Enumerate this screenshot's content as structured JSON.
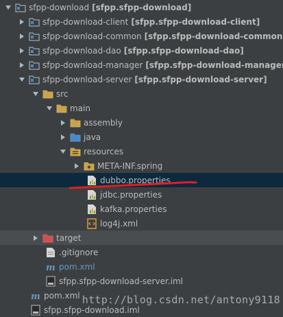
{
  "tree": {
    "root": {
      "name": "sfpp-download",
      "module": "[sfpp.sfpp-download]"
    },
    "client": {
      "name": "sfpp-download-client",
      "module": "[sfpp.sfpp-download-client]"
    },
    "common": {
      "name": "sfpp-download-common",
      "module": "[sfpp.sfpp-download-common]"
    },
    "dao": {
      "name": "sfpp-download-dao",
      "module": "[sfpp.sfpp-download-dao]"
    },
    "manager": {
      "name": "sfpp-download-manager",
      "module": "[sfpp.sfpp-download-manager]"
    },
    "server": {
      "name": "sfpp-download-server",
      "module": "[sfpp.sfpp-download-server]"
    },
    "src": "src",
    "main": "main",
    "assembly": "assembly",
    "java": "java",
    "resources": "resources",
    "meta_inf": "META-INF.spring",
    "dubbo": "dubbo.properties",
    "jdbc": "jdbc.properties",
    "kafka": "kafka.properties",
    "log4j": "log4j.xml",
    "target": "target",
    "gitignore": ".gitignore",
    "server_pom": "pom.xml",
    "server_iml": "sfpp.sfpp-download-server.iml",
    "root_pom": "pom.xml",
    "root_iml": "sfpp.sfpp-download.iml"
  },
  "watermark": "http://blog.csdn.net/antony9118",
  "colors": {
    "background": "#3c3f41",
    "selected_row": "#0d293e",
    "highlight_row": "#4a4d4f",
    "annotation": "#e02020",
    "pom_text": "#6897bb"
  }
}
